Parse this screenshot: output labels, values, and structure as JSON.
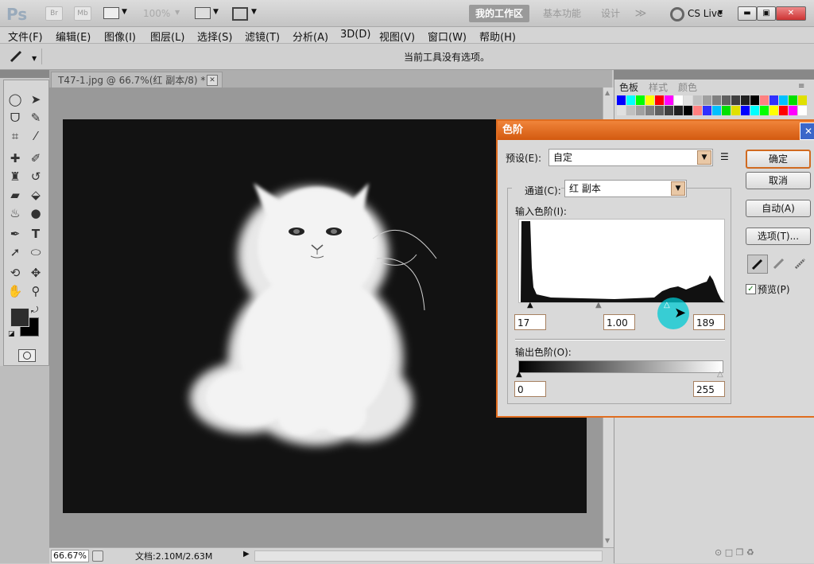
{
  "appbar": {
    "logo": "Ps",
    "bridge_label": "Br",
    "minibridge_label": "Mb",
    "zoom_level": "100%",
    "workspaces": [
      "我的工作区",
      "基本功能",
      "设计"
    ],
    "overflow": "≫",
    "cs_live": "CS Live"
  },
  "menu": [
    "文件(F)",
    "编辑(E)",
    "图像(I)",
    "图层(L)",
    "选择(S)",
    "滤镜(T)",
    "分析(A)",
    "3D(D)",
    "视图(V)",
    "窗口(W)",
    "帮助(H)"
  ],
  "options_bar": {
    "message": "当前工具没有选项。"
  },
  "document": {
    "tab_title": "T47-1.jpg @ 66.7%(红 副本/8) *",
    "close": "✕"
  },
  "status": {
    "zoom": "66.67%",
    "doc_size": "文档:2.10M/2.63M"
  },
  "panels": {
    "tabs": [
      "色板",
      "样式",
      "颜色"
    ]
  },
  "colors": {
    "swatches": [
      "#0000ff",
      "#00ffff",
      "#00ff00",
      "#ffff00",
      "#ff0000",
      "#ff00ff",
      "#ffffff",
      "#e0e0e0",
      "#c0c0c0",
      "#a0a0a0",
      "#808080",
      "#606060",
      "#404040",
      "#202020",
      "#000000",
      "#ff8080",
      "#3030ff",
      "#00c0ff",
      "#00e000",
      "#e0e000"
    ],
    "accent": "#e06d20"
  },
  "levels_dialog": {
    "title": "色阶",
    "preset_label": "预设(E):",
    "preset_value": "自定",
    "channel_label": "通道(C):",
    "channel_value": "红 副本",
    "input_label": "输入色阶(I):",
    "input_black": "17",
    "input_gamma": "1.00",
    "input_white": "189",
    "output_label": "输出色阶(O):",
    "output_black": "0",
    "output_white": "255",
    "buttons": {
      "ok": "确定",
      "cancel": "取消",
      "auto": "自动(A)",
      "options": "选项(T)..."
    },
    "preview_label": "预览(P)",
    "preview_checked": true
  }
}
